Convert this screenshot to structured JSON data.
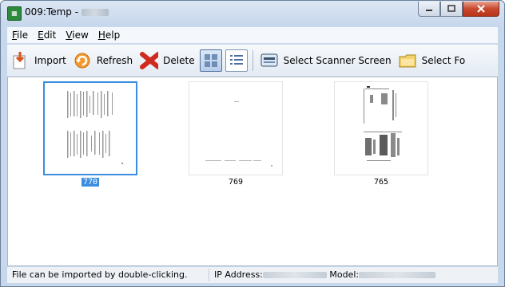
{
  "window": {
    "title": "009:Temp -"
  },
  "menu": [
    {
      "label": "File",
      "mnemonic": "F",
      "rest": "ile"
    },
    {
      "label": "Edit",
      "mnemonic": "E",
      "rest": "dit"
    },
    {
      "label": "View",
      "mnemonic": "V",
      "rest": "iew"
    },
    {
      "label": "Help",
      "mnemonic": "H",
      "rest": "elp"
    }
  ],
  "toolbar": {
    "import_label": "Import",
    "refresh_label": "Refresh",
    "delete_label": "Delete",
    "select_scanner_label": "Select Scanner Screen",
    "select_folder_label": "Select Fo"
  },
  "thumbnails": [
    {
      "label": "770",
      "selected": true
    },
    {
      "label": "769",
      "selected": false
    },
    {
      "label": "765",
      "selected": false
    }
  ],
  "status": {
    "hint": "File can be imported by double-clicking.",
    "ip_label": "IP Address:",
    "model_label": "Model:"
  },
  "icons": {
    "import": "import-icon",
    "refresh": "refresh-icon",
    "delete": "delete-icon",
    "thumbnail_view": "thumbnail-view-icon",
    "list_view": "list-view-icon",
    "scanner": "scanner-screen-icon",
    "folder": "folder-icon"
  },
  "colors": {
    "selection": "#3b8de0",
    "close_button": "#c8492e"
  }
}
